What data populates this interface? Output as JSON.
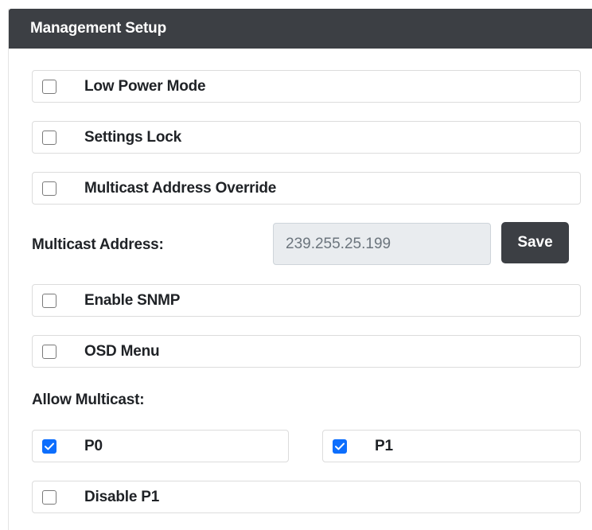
{
  "panel": {
    "title": "Management Setup"
  },
  "options": {
    "low_power_mode": {
      "label": "Low Power Mode",
      "checked": false
    },
    "settings_lock": {
      "label": "Settings Lock",
      "checked": false
    },
    "multicast_address_override": {
      "label": "Multicast Address Override",
      "checked": false
    },
    "enable_snmp": {
      "label": "Enable SNMP",
      "checked": false
    },
    "osd_menu": {
      "label": "OSD Menu",
      "checked": false
    },
    "p0": {
      "label": "P0",
      "checked": true
    },
    "p1": {
      "label": "P1",
      "checked": true
    },
    "disable_p1": {
      "label": "Disable P1",
      "checked": false
    }
  },
  "multicast_address": {
    "label": "Multicast Address:",
    "value": "239.255.25.199",
    "save_label": "Save"
  },
  "allow_multicast": {
    "label": "Allow Multicast:"
  },
  "colors": {
    "header_bg": "#3c3f44",
    "checked_bg": "#0d6efd",
    "input_bg": "#e9ecef"
  }
}
